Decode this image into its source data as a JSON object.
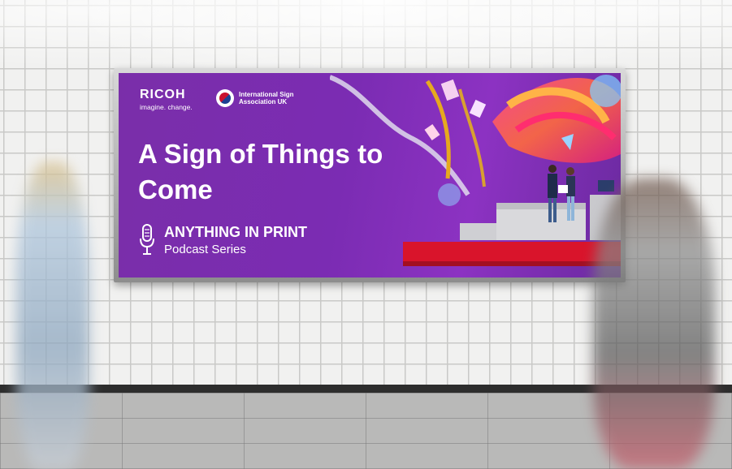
{
  "ad": {
    "brand_name": "RICOH",
    "brand_tagline": "imagine. change.",
    "partner_name": "International Sign Association UK",
    "headline": "A Sign of Things to Come",
    "podcast_title": "ANYTHING IN PRINT",
    "podcast_subtitle": "Podcast Series"
  },
  "colors": {
    "ad_background": "#7b2cb3",
    "stage_red": "#d9142b",
    "tile_wall": "#f1f1f0",
    "floor": "#b9b9b8"
  },
  "icons": {
    "podcast": "microphone-icon",
    "partner": "isa-logo-icon"
  }
}
